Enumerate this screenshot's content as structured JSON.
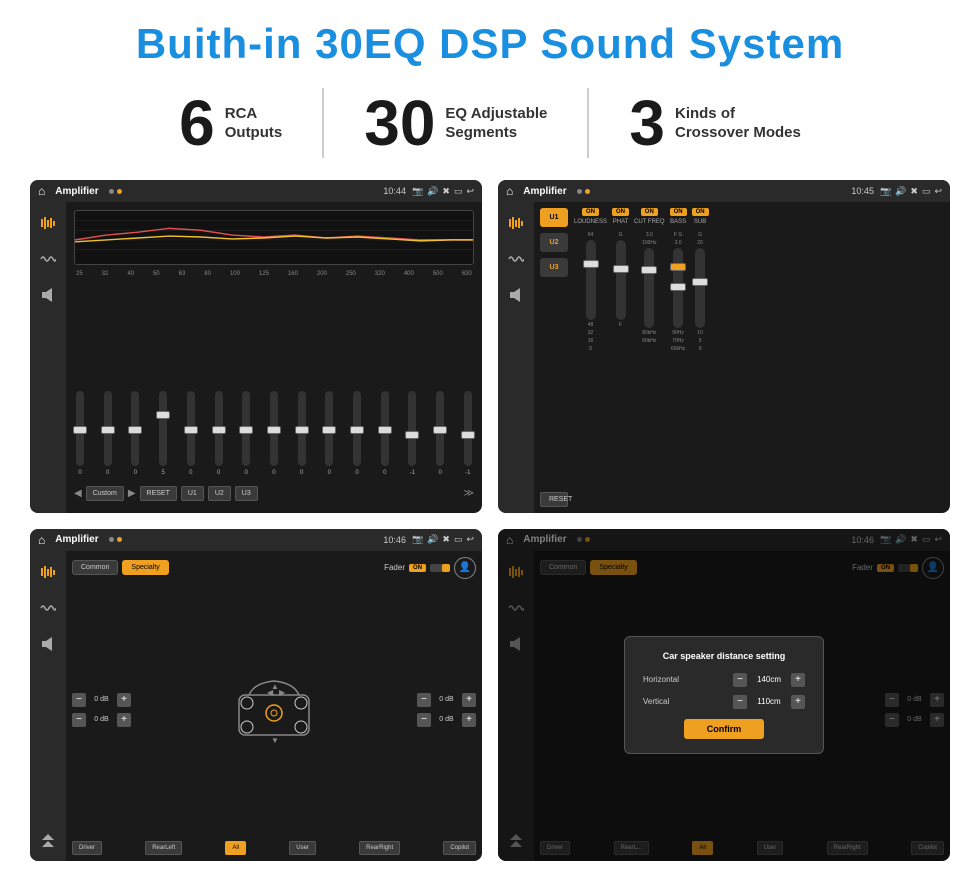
{
  "title": "Buith-in 30EQ DSP Sound System",
  "stats": [
    {
      "number": "6",
      "label": "RCA\nOutputs"
    },
    {
      "number": "30",
      "label": "EQ Adjustable\nSegments"
    },
    {
      "number": "3",
      "label": "Kinds of\nCrossover Modes"
    }
  ],
  "screens": [
    {
      "id": "eq-screen",
      "status_time": "10:44",
      "app_title": "Amplifier",
      "eq_freqs": [
        "25",
        "32",
        "40",
        "50",
        "63",
        "80",
        "100",
        "125",
        "160",
        "200",
        "250",
        "320",
        "400",
        "500",
        "630"
      ],
      "eq_values": [
        "0",
        "0",
        "0",
        "5",
        "0",
        "0",
        "0",
        "0",
        "0",
        "0",
        "0",
        "0",
        "-1",
        "0",
        "-1"
      ],
      "eq_preset": "Custom",
      "eq_presets": [
        "U1",
        "U2",
        "U3"
      ]
    },
    {
      "id": "crossover-screen",
      "status_time": "10:45",
      "app_title": "Amplifier",
      "presets": [
        "U1",
        "U2",
        "U3"
      ],
      "channels": [
        {
          "label": "LOUDNESS",
          "on": true
        },
        {
          "label": "PHAT",
          "on": true
        },
        {
          "label": "CUT FREQ",
          "on": true
        },
        {
          "label": "BASS",
          "on": true
        },
        {
          "label": "SUB",
          "on": true
        }
      ],
      "reset_label": "RESET"
    },
    {
      "id": "fader-screen",
      "status_time": "10:46",
      "app_title": "Amplifier",
      "tabs": [
        "Common",
        "Specialty"
      ],
      "fader_label": "Fader",
      "fader_on": "ON",
      "speaker_positions": [
        {
          "id": "fl",
          "db": "0 dB"
        },
        {
          "id": "fr",
          "db": "0 dB"
        },
        {
          "id": "rl",
          "db": "0 dB"
        },
        {
          "id": "rr",
          "db": "0 dB"
        }
      ],
      "bottom_btns": [
        "Driver",
        "RearLeft",
        "All",
        "User",
        "RearRight",
        "Copilot"
      ]
    },
    {
      "id": "distance-screen",
      "status_time": "10:46",
      "app_title": "Amplifier",
      "tabs": [
        "Common",
        "Specialty"
      ],
      "fader_label": "Fader",
      "fader_on": "ON",
      "modal": {
        "title": "Car speaker distance setting",
        "rows": [
          {
            "label": "Horizontal",
            "value": "140cm"
          },
          {
            "label": "Vertical",
            "value": "110cm"
          }
        ],
        "confirm_label": "Confirm"
      },
      "speaker_right": [
        {
          "db": "0 dB"
        },
        {
          "db": "0 dB"
        }
      ],
      "bottom_btns": [
        "Driver",
        "RearLeft",
        "All",
        "User",
        "RearRight",
        "Copilot"
      ]
    }
  ]
}
